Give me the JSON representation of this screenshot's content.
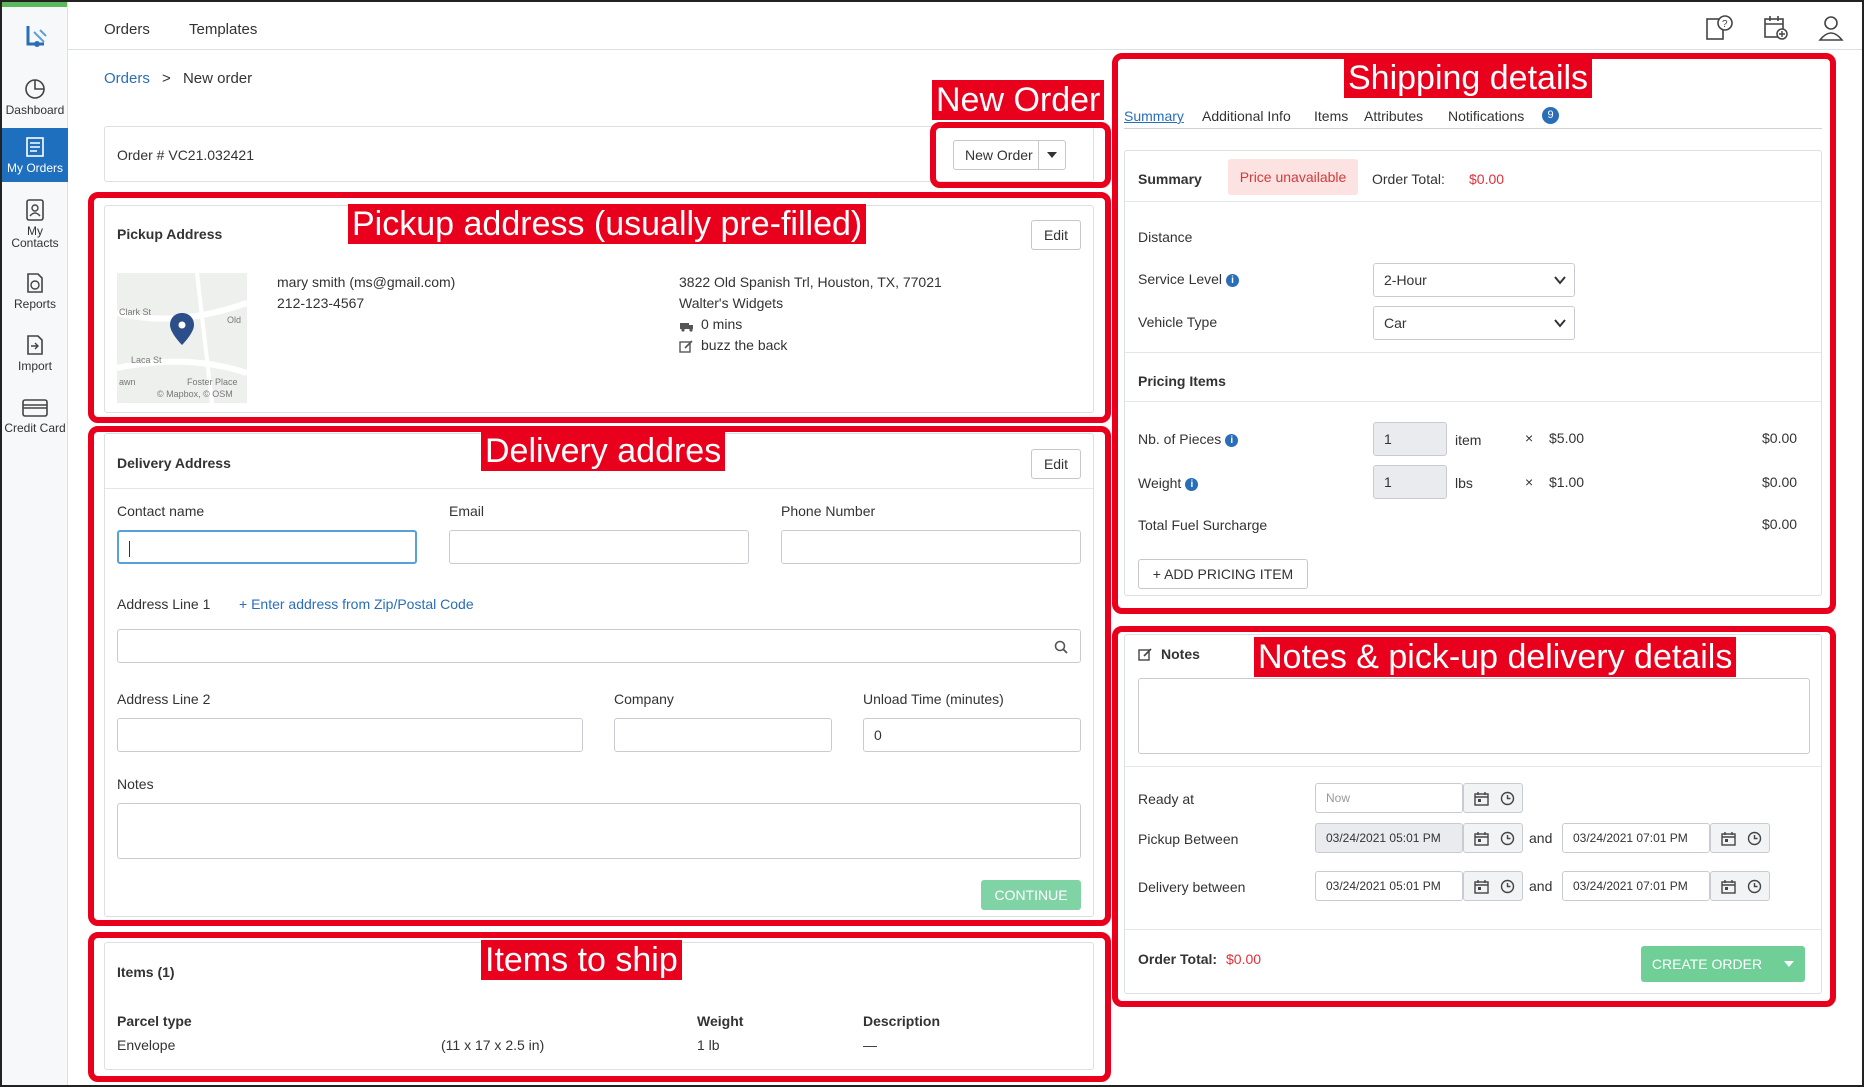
{
  "sidebar": {
    "items": [
      {
        "label": "Dashboard",
        "icon": "dashboard-icon"
      },
      {
        "label": "My Orders",
        "icon": "orders-icon"
      },
      {
        "label": "My Contacts",
        "label_line1": "My",
        "label_line2": "Contacts",
        "icon": "contacts-icon"
      },
      {
        "label": "Reports",
        "icon": "reports-icon"
      },
      {
        "label": "Import",
        "icon": "import-icon"
      },
      {
        "label": "Credit Card",
        "icon": "credit-card-icon"
      }
    ],
    "accent": "#1f6fbf",
    "top_accent": "#5bb85b"
  },
  "topnav": {
    "links": [
      "Orders",
      "Templates"
    ],
    "icons": [
      "help-guide-icon",
      "calendar-add-icon",
      "user-icon"
    ]
  },
  "breadcrumb": {
    "root": "Orders",
    "separator": ">",
    "current": "New order"
  },
  "order": {
    "number_label": "Order # VC21.032421",
    "new_order_button": "New Order"
  },
  "pickup": {
    "title": "Pickup Address",
    "edit": "Edit",
    "contact": "mary smith (ms@gmail.com)",
    "phone": "212-123-4567",
    "address": "3822 Old Spanish Trl, Houston, TX, 77021",
    "company": "Walter's Widgets",
    "load_time": "0 mins",
    "note": "buzz the back",
    "map_credit": "© Mapbox, © OSM",
    "map_labels": [
      "Clark St",
      "Old",
      "Laca St",
      "awn",
      "Foster Place"
    ]
  },
  "delivery": {
    "title": "Delivery Address",
    "edit": "Edit",
    "contact_label": "Contact name",
    "email_label": "Email",
    "phone_label": "Phone Number",
    "addr1_label": "Address Line 1",
    "zip_link": "+ Enter address from Zip/Postal Code",
    "addr2_label": "Address Line 2",
    "company_label": "Company",
    "unload_label": "Unload Time (minutes)",
    "unload_value": "0",
    "notes_label": "Notes",
    "continue": "CONTINUE"
  },
  "items": {
    "title": "Items (1)",
    "headers": [
      "Parcel type",
      "Weight",
      "Description"
    ],
    "rows": [
      {
        "type": "Envelope",
        "dims": "(11 x 17 x 2.5 in)",
        "weight": "1 lb",
        "description": "—"
      }
    ]
  },
  "shipping": {
    "tabs": [
      "Summary",
      "Additional Info",
      "Items",
      "Attributes",
      "Notifications"
    ],
    "notifications_badge": "9",
    "summary_label": "Summary",
    "price_badge": "Price unavailable",
    "order_total_label": "Order Total:",
    "order_total_value": "$0.00",
    "distance_label": "Distance",
    "service_level_label": "Service Level",
    "service_level_value": "2-Hour",
    "vehicle_type_label": "Vehicle Type",
    "vehicle_type_value": "Car",
    "pricing_items_label": "Pricing Items",
    "pieces_label": "Nb. of Pieces",
    "pieces_value": "1",
    "pieces_unit": "item",
    "pieces_rate": "$5.00",
    "pieces_total": "$0.00",
    "weight_label": "Weight",
    "weight_value": "1",
    "weight_unit": "lbs",
    "weight_rate": "$1.00",
    "weight_total": "$0.00",
    "times": "×",
    "fuel_label": "Total Fuel Surcharge",
    "fuel_total": "$0.00",
    "add_pricing": "+ ADD PRICING ITEM"
  },
  "notes_panel": {
    "title": "Notes",
    "ready_at_label": "Ready at",
    "ready_at_placeholder": "Now",
    "pickup_between_label": "Pickup Between",
    "pickup_from": "03/24/2021 05:01 PM",
    "pickup_to": "03/24/2021 07:01 PM",
    "delivery_between_label": "Delivery between",
    "delivery_from": "03/24/2021 05:01 PM",
    "delivery_to": "03/24/2021 07:01 PM",
    "and": "and",
    "order_total_label": "Order Total:",
    "order_total_value": "$0.00",
    "create_order": "CREATE ORDER"
  },
  "annotations": {
    "new_order": "New Order",
    "shipping": "Shipping details",
    "pickup": "Pickup address (usually pre-filled)",
    "delivery": "Delivery addres",
    "items": "Items to ship",
    "notes": "Notes & pick-up delivery details",
    "color": "#e8001c"
  },
  "colors": {
    "price_red": "#e0303a",
    "green": "#6fcf97",
    "link": "#2a6eb8"
  }
}
